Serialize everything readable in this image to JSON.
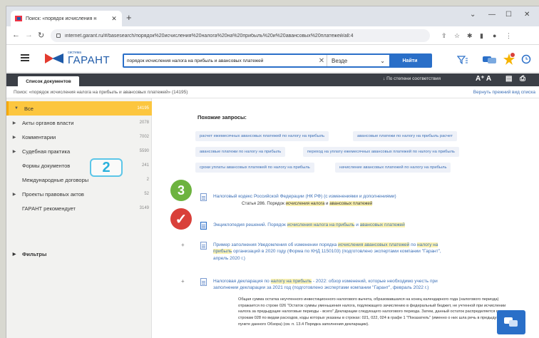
{
  "browser": {
    "tab_title": "Поиск: «порядок исчисления н",
    "tab_close": "✕",
    "new_tab": "+",
    "url": "internet.garant.ru/#/basesearch/порядок%20исчисления%20налога%20на%20прибыль%20и%20авансовых%20платежей/all:4",
    "win_min": "—",
    "win_max": "☐",
    "win_close": "✕",
    "win_chevron": "⌄"
  },
  "header": {
    "logo_small": "система",
    "logo_big": "ГАРАНТ",
    "search_query": "порядок исчисления налога на прибыль и авансовых платежей",
    "search_scope": "Везде",
    "search_button": "Найти"
  },
  "toolbar": {
    "doc_list_tab": "Список документов",
    "sort_label": "По степени соответствия",
    "font_label": "A⁺ A"
  },
  "breadcrumb": {
    "query": "Поиск: «порядок исчисления налога на прибыль и авансовых платежей» (14195)",
    "back_link": "Вернуть прежний вид списка"
  },
  "sidebar": {
    "items": [
      {
        "label": "Все",
        "count": "14195",
        "arrow": "▼"
      },
      {
        "label": "Акты органов власти",
        "count": "2078",
        "arrow": "▶"
      },
      {
        "label": "Комментарии",
        "count": "7002",
        "arrow": "▶"
      },
      {
        "label": "Судебная практика",
        "count": "5590",
        "arrow": "▶"
      },
      {
        "label": "Формы документов",
        "count": "241",
        "arrow": ""
      },
      {
        "label": "Международные договоры",
        "count": "2",
        "arrow": ""
      },
      {
        "label": "Проекты правовых актов",
        "count": "52",
        "arrow": "▶"
      },
      {
        "label": "ГАРАНТ рекомендует",
        "count": "3149",
        "arrow": ""
      }
    ],
    "filters_label": "Фильтры",
    "filters_arrow": "▶"
  },
  "annotations": {
    "badge_two": "2",
    "badge_three": "3",
    "check": "✓"
  },
  "similar": {
    "title": "Похожие запросы:",
    "chips": [
      "расчет ежемесячных авансовых платежей по налогу на прибыль",
      "авансовые платежи по налогу на прибыль расчет",
      "авансовые платежи по налогу на прибыль",
      "переход на уплату ежемесячных авансовых платежей по налогу на прибыль",
      "сроки уплаты авансовых платежей по налогу на прибыль",
      "начисление авансовых платежей по налогу на прибыль"
    ]
  },
  "results": [
    {
      "title": "Налоговый кодекс Российской Федерации (НК РФ) (с изменениями и дополнениями)",
      "sub_prefix": "Статья 286. Порядок ",
      "sub_hl": "исчисления налога",
      "sub_mid": " и ",
      "sub_hl2": "авансовых платежей"
    },
    {
      "title_prefix": "Энциклопедия решений. Порядок ",
      "title_hl": "исчисления налога на прибыль",
      "title_mid": " и ",
      "title_hl2": "авансовых платежей"
    },
    {
      "line1_prefix": "Пример заполнения Уведомления об изменении порядка ",
      "line1_hl": "исчисления авансовых платежей",
      "line1_mid": " по ",
      "line1_hl2": "налогу на",
      "line2_hl": "прибыль",
      "line2_rest": " организаций в 2020 году (Форма по КНД 1150103) (подготовлено экспертами компании \"Гарант\",",
      "line3": "апрель 2020 г.)"
    },
    {
      "line1_prefix": "Налоговая декларация по ",
      "line1_hl": "налогу на прибыль",
      "line1_rest": " - 2022: обзор изменений, которые необходимо учесть при",
      "line2": "заполнении декларации за 2021 год (подготовлено экспертами компании \"Гарант\", февраль 2022 г.)",
      "snippet": "Общая сумма остатка неучтенного инвестиционного налогового вычета, образовавшаяся на конец календарного года (налогового периода) отражается по строке 026 \"Остаток суммы уменьшения налога, подлежащего зачислению в федеральный бюджет, не учтенной при исчислении налога за предыдущие налоговые периоды - всего\" Декларации следующего налогового периода. Затем, данный остаток распределяется по строкам 028 по видам расходов, коды которых указаны в строках: 021, 022, 024 в графе 1 \"Показатель\" (именно о них шла речь в предыдущем пункте данного Обзора) (см. п. 13.4 Порядка заполнения декларации)."
    }
  ],
  "colors": {
    "accent_blue": "#2a6fc8",
    "active_yellow": "#fcc63f",
    "badge_green": "#6db33f",
    "badge_red": "#d9403a"
  }
}
